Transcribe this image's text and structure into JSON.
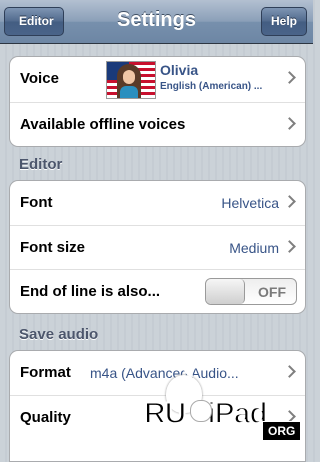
{
  "navbar": {
    "title": "Settings",
    "back_label": "Editor",
    "help_label": "Help"
  },
  "voice_group": {
    "voice_label": "Voice",
    "voice_name": "Olivia",
    "voice_language": "English (American) ...",
    "offline_label": "Available offline voices"
  },
  "editor_section": {
    "header": "Editor",
    "font_label": "Font",
    "font_value": "Helvetica",
    "font_size_label": "Font size",
    "font_size_value": "Medium",
    "eol_label": "End of line is also...",
    "eol_state": "OFF"
  },
  "save_audio_section": {
    "header": "Save audio",
    "format_label": "Format",
    "format_value": "m4a (Advanced Audio...",
    "quality_label": "Quality"
  },
  "watermark": {
    "text_left": "RU",
    "text_right": "iPad",
    "org": "ORG"
  },
  "colors": {
    "navbar": "#7790ad",
    "value_blue": "#385487",
    "section_header": "#4c566c"
  }
}
